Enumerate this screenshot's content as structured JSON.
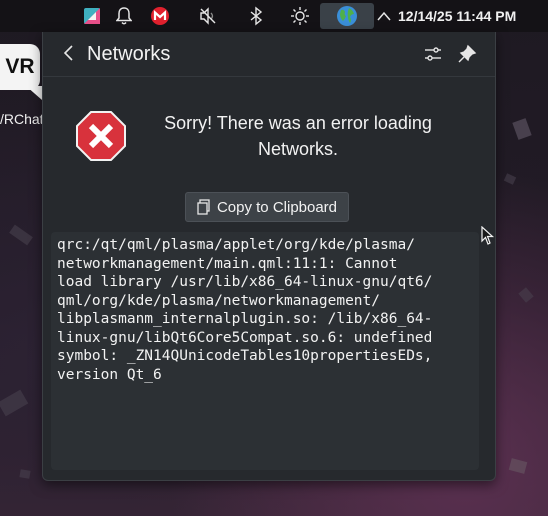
{
  "taskbar": {
    "tray": [
      {
        "name": "kde-connect-icon",
        "glyph": "◢"
      },
      {
        "name": "bell-icon",
        "glyph": "🔔"
      },
      {
        "name": "mail-m-icon",
        "glyph": "M"
      },
      {
        "name": "volume-muted-icon",
        "glyph": "🔇"
      },
      {
        "name": "bluetooth-icon",
        "glyph": "ᛒ"
      },
      {
        "name": "brightness-icon",
        "glyph": "☼"
      }
    ],
    "network_globe": "🌏",
    "expand_arrow": "^",
    "clock": "12/14/25 11:44 PM"
  },
  "desktop": {
    "icon_text": "VR",
    "label": "/RChat"
  },
  "popup": {
    "title": "Networks",
    "back_glyph": "<",
    "error_message": "Sorry! There was an error loading Networks.",
    "copy_button_label": "Copy to Clipboard",
    "error_log": "qrc:/qt/qml/plasma/applet/org/kde/plasma/\nnetworkmanagement/main.qml:11:1: Cannot\nload library /usr/lib/x86_64-linux-gnu/qt6/\nqml/org/kde/plasma/networkmanagement/\nlibplasmanm_internalplugin.so: /lib/x86_64-\nlinux-gnu/libQt6Core5Compat.so.6: undefined\nsymbol: _ZN14QUnicodeTables10propertiesEDs,\nversion Qt_6"
  },
  "colors": {
    "error_red": "#d8323c",
    "mail_red": "#e0212e",
    "popup_bg": "#26292d",
    "log_bg": "#2c3034"
  }
}
